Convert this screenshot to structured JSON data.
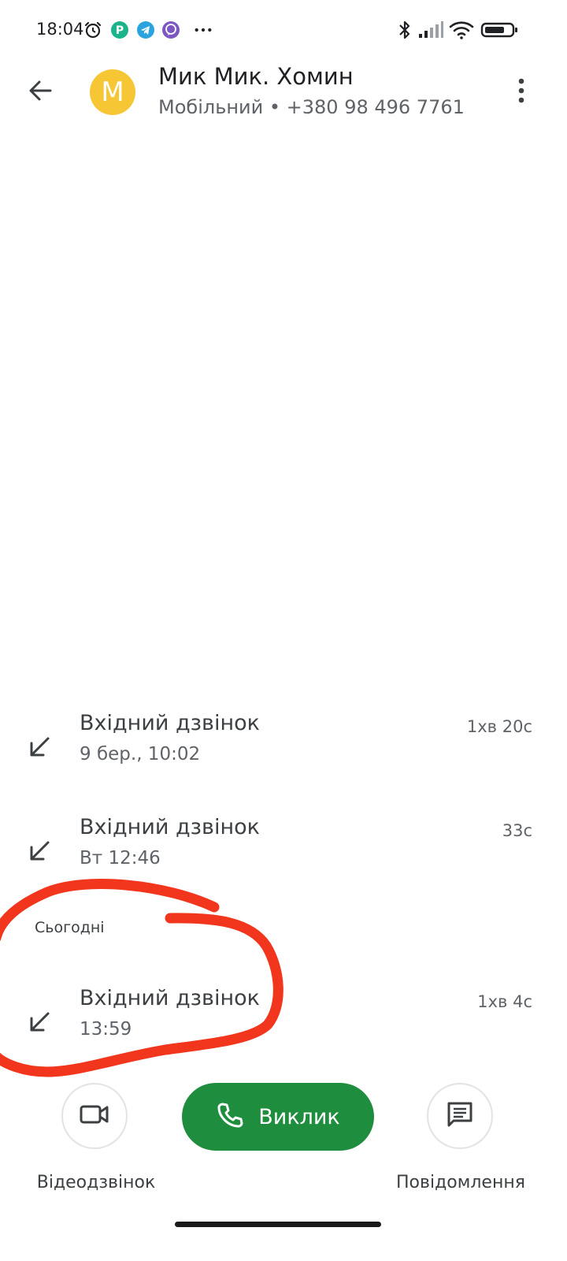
{
  "status_bar": {
    "time": "18:04",
    "icons_left": [
      "alarm-icon",
      "payment-app-icon",
      "telegram-icon",
      "viber-icon",
      "more-notifications-icon"
    ],
    "icons_right": [
      "bluetooth-icon",
      "signal-icon",
      "wifi-icon",
      "battery-icon"
    ]
  },
  "header": {
    "avatar_letter": "M",
    "avatar_color": "#f6c634",
    "name": "Мик Мик. Хомин",
    "subtitle": "Мобільний • +380 98 496 7761"
  },
  "calls": [
    {
      "title": "Вхідний дзвінок",
      "time": "9 бер., 10:02",
      "duration": "1хв 20с"
    },
    {
      "title": "Вхідний дзвінок",
      "time": "Вт 12:46",
      "duration": "33с"
    }
  ],
  "today_section": {
    "label": "Сьогодні",
    "calls": [
      {
        "title": "Вхідний дзвінок",
        "time": "13:59",
        "duration": "1хв 4с"
      }
    ]
  },
  "actions": {
    "video_label": "Відеодзвінок",
    "call_label": "Виклик",
    "message_label": "Повідомлення"
  },
  "colors": {
    "call_button": "#1e8e3e",
    "annotation_stroke": "#f2361d"
  }
}
